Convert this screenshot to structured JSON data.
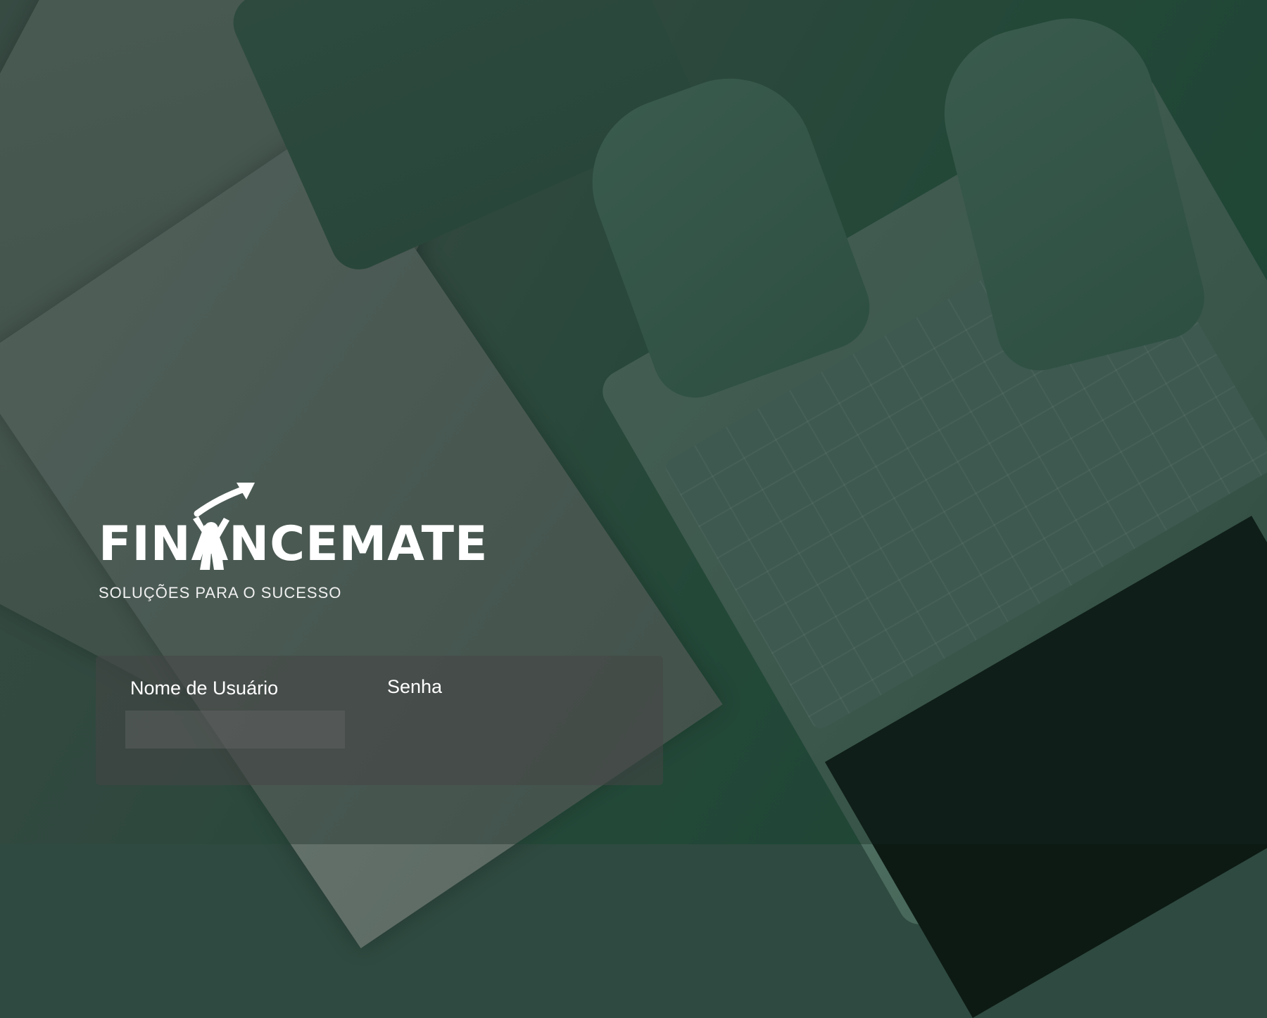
{
  "brand": {
    "title": "FINANCEMATE",
    "tagline": "SOLUÇÕES PARA O SUCESSO",
    "logo_icon": "person-arrow-up-icon"
  },
  "login": {
    "username_label": "Nome de Usuário",
    "username_value": "",
    "password_label": "Senha",
    "password_value": ""
  },
  "colors": {
    "text": "#ffffff",
    "tint": "#2c5a46"
  }
}
